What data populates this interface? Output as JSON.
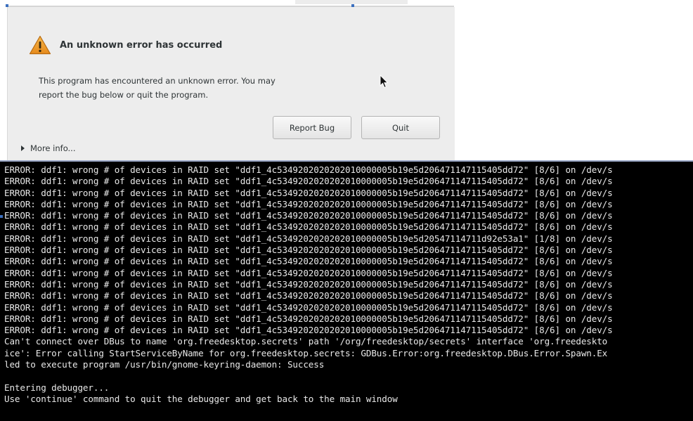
{
  "dialog": {
    "title": "An unknown error has occurred",
    "message_line1": "This program has encountered an unknown error. You may",
    "message_line2": "report the bug below or quit the program.",
    "report_bug_label": "Report Bug",
    "quit_label": "Quit",
    "more_info_label": "More info..."
  },
  "icons": {
    "warning": "warning-icon",
    "expander": "expander-arrow-icon",
    "cursor": "mouse-pointer-icon"
  },
  "colors": {
    "warning_fill": "#f0a030",
    "terminal_bg": "#000000",
    "terminal_text": "#e8e8e8",
    "dialog_bg": "#ededed"
  },
  "terminal": {
    "lines": [
      "ERROR: ddf1: wrong # of devices in RAID set \"ddf1_4c5349202020202010000005b19e5d206471147115405dd72\" [8/6] on /dev/s",
      "ERROR: ddf1: wrong # of devices in RAID set \"ddf1_4c5349202020202010000005b19e5d206471147115405dd72\" [8/6] on /dev/s",
      "ERROR: ddf1: wrong # of devices in RAID set \"ddf1_4c5349202020202010000005b19e5d206471147115405dd72\" [8/6] on /dev/s",
      "ERROR: ddf1: wrong # of devices in RAID set \"ddf1_4c5349202020202010000005b19e5d206471147115405dd72\" [8/6] on /dev/s",
      "ERROR: ddf1: wrong # of devices in RAID set \"ddf1_4c5349202020202010000005b19e5d206471147115405dd72\" [8/6] on /dev/s",
      "ERROR: ddf1: wrong # of devices in RAID set \"ddf1_4c5349202020202010000005b19e5d206471147115405dd72\" [8/6] on /dev/s",
      "ERROR: ddf1: wrong # of devices in RAID set \"ddf1_4c5349202020202010000005b19e5d20547114711d92e53a1\" [1/8] on /dev/s",
      "ERROR: ddf1: wrong # of devices in RAID set \"ddf1_4c5349202020202010000005b19e5d206471147115405dd72\" [8/6] on /dev/s",
      "ERROR: ddf1: wrong # of devices in RAID set \"ddf1_4c5349202020202010000005b19e5d206471147115405dd72\" [8/6] on /dev/s",
      "ERROR: ddf1: wrong # of devices in RAID set \"ddf1_4c5349202020202010000005b19e5d206471147115405dd72\" [8/6] on /dev/s",
      "ERROR: ddf1: wrong # of devices in RAID set \"ddf1_4c5349202020202010000005b19e5d206471147115405dd72\" [8/6] on /dev/s",
      "ERROR: ddf1: wrong # of devices in RAID set \"ddf1_4c5349202020202010000005b19e5d206471147115405dd72\" [8/6] on /dev/s",
      "ERROR: ddf1: wrong # of devices in RAID set \"ddf1_4c5349202020202010000005b19e5d206471147115405dd72\" [8/6] on /dev/s",
      "ERROR: ddf1: wrong # of devices in RAID set \"ddf1_4c5349202020202010000005b19e5d206471147115405dd72\" [8/6] on /dev/s",
      "ERROR: ddf1: wrong # of devices in RAID set \"ddf1_4c5349202020202010000005b19e5d206471147115405dd72\" [8/6] on /dev/s",
      "Can't connect over DBus to name 'org.freedesktop.secrets' path '/org/freedesktop/secrets' interface 'org.freedeskto",
      "ice': Error calling StartServiceByName for org.freedesktop.secrets: GDBus.Error:org.freedesktop.DBus.Error.Spawn.Ex",
      "led to execute program /usr/bin/gnome-keyring-daemon: Success",
      "",
      "Entering debugger...",
      "Use 'continue' command to quit the debugger and get back to the main window"
    ]
  }
}
